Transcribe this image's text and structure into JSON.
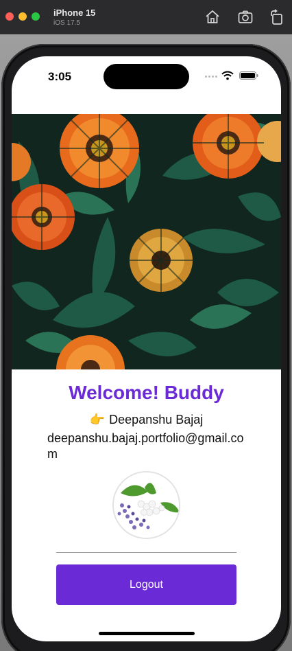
{
  "window": {
    "title": "iPhone 15",
    "subtitle": "iOS 17.5",
    "icons": [
      "home-icon",
      "screenshot-icon",
      "rotate-icon"
    ]
  },
  "status_bar": {
    "time": "3:05",
    "icons": [
      "signal-icon",
      "wifi-icon",
      "battery-icon"
    ]
  },
  "profile": {
    "greeting": "Welcome! Buddy",
    "pointer_emoji": "👉",
    "name": "Deepanshu Bajaj",
    "email": "deepanshu.bajaj.portfolio@gmail.com"
  },
  "actions": {
    "logout_label": "Logout"
  },
  "colors": {
    "accent": "#6a2ad6",
    "title_bar": "#2b2b2d"
  }
}
